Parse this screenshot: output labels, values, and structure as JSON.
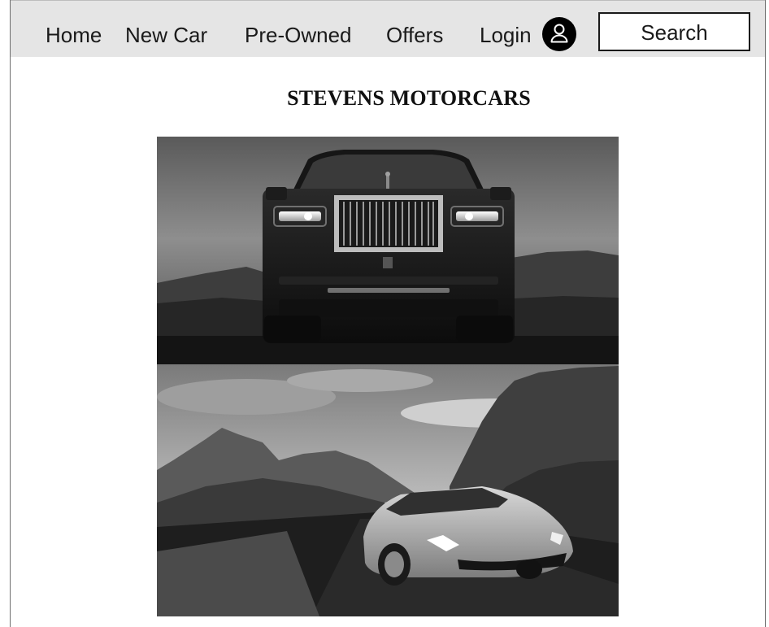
{
  "nav": {
    "home": "Home",
    "new_car": "New Car",
    "pre_owned": "Pre-Owned",
    "offers": "Offers",
    "login": "Login",
    "user_icon": "user-icon",
    "search": "Search"
  },
  "header": {
    "title": "STEVENS MOTORCARS"
  },
  "hero_images": [
    {
      "subject": "front view of luxury SUV on dark road with mountains"
    },
    {
      "subject": "sports car driving on desert canyon road"
    }
  ]
}
